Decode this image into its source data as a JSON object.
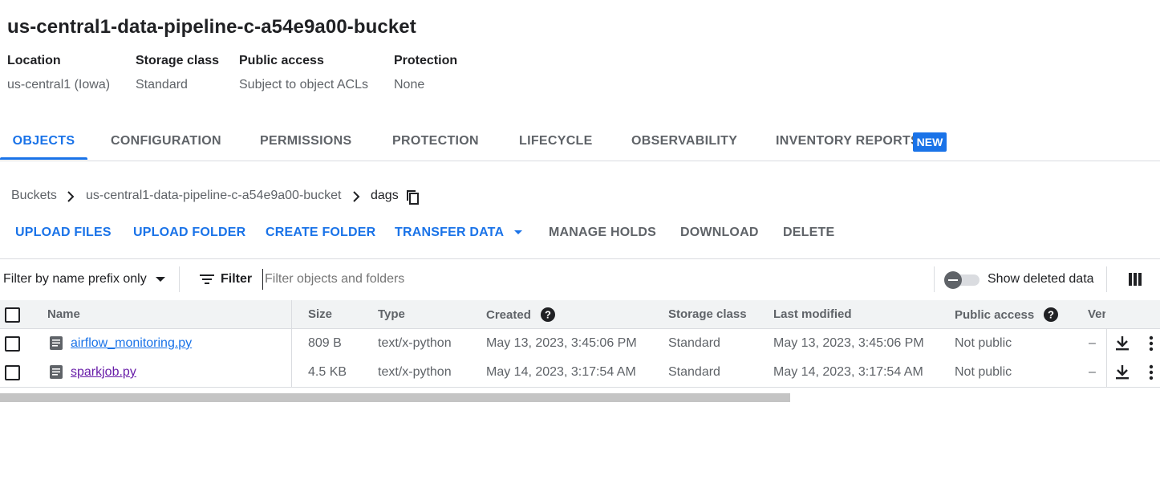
{
  "bucket": {
    "title": "us-central1-data-pipeline-c-a54e9a00-bucket",
    "meta": [
      {
        "label": "Location",
        "value": "us-central1 (Iowa)"
      },
      {
        "label": "Storage class",
        "value": "Standard"
      },
      {
        "label": "Public access",
        "value": "Subject to object ACLs"
      },
      {
        "label": "Protection",
        "value": "None"
      }
    ]
  },
  "tabs": [
    "OBJECTS",
    "CONFIGURATION",
    "PERMISSIONS",
    "PROTECTION",
    "LIFECYCLE",
    "OBSERVABILITY",
    "INVENTORY REPORTS"
  ],
  "tab_badge": "NEW",
  "active_tab": "OBJECTS",
  "breadcrumb": [
    "Buckets",
    "us-central1-data-pipeline-c-a54e9a00-bucket",
    "dags"
  ],
  "actions": {
    "upload_files": "UPLOAD FILES",
    "upload_folder": "UPLOAD FOLDER",
    "create_folder": "CREATE FOLDER",
    "transfer_data": "TRANSFER DATA",
    "manage_holds": "MANAGE HOLDS",
    "download": "DOWNLOAD",
    "delete": "DELETE"
  },
  "filterbar": {
    "mode": "Filter by name prefix only",
    "filter_label": "Filter",
    "placeholder": "Filter objects and folders",
    "show_deleted": "Show deleted data",
    "show_deleted_on": false
  },
  "table": {
    "headers": [
      "Name",
      "Size",
      "Type",
      "Created",
      "Storage class",
      "Last modified",
      "Public access",
      "Ver"
    ],
    "rows": [
      {
        "name": "airflow_monitoring.py",
        "size": "809 B",
        "type": "text/x-python",
        "created": "May 13, 2023, 3:45:06 PM",
        "storage_class": "Standard",
        "last_modified": "May 13, 2023, 3:45:06 PM",
        "public_access": "Not public",
        "version": "–"
      },
      {
        "name": "sparkjob.py",
        "size": "4.5 KB",
        "type": "text/x-python",
        "created": "May 14, 2023, 3:17:54 AM",
        "storage_class": "Standard",
        "last_modified": "May 14, 2023, 3:17:54 AM",
        "public_access": "Not public",
        "version": "–"
      }
    ]
  },
  "colors": {
    "accent": "#1a73e8",
    "text_primary": "#202124",
    "text_secondary": "#5f6368",
    "visited_link": "#681da8",
    "divider": "#dadce0",
    "header_bg": "#f1f3f4"
  },
  "icons": {
    "copy": "copy-icon",
    "chevron": "chevron-right-icon",
    "filter": "filter-list-icon",
    "file": "file-document-icon",
    "help": "help-icon",
    "download": "download-icon",
    "more": "more-vert-icon",
    "columns": "column-display-icon"
  }
}
